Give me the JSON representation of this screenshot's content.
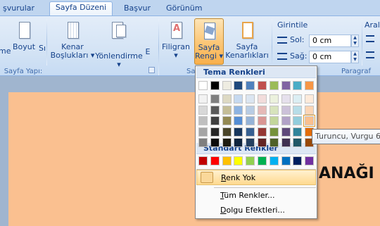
{
  "tabs": [
    {
      "label": "şvurular",
      "active": false
    },
    {
      "label": "Sayfa Düzeni",
      "active": true
    },
    {
      "label": "Başvur",
      "active": false
    },
    {
      "label": "Görünüm",
      "active": false
    }
  ],
  "ribbon": {
    "page_setup": {
      "label": "Sayfa Yapı:",
      "buttons": {
        "edge": "me",
        "size": "Boyut",
        "su": "Sı",
        "margins_1": "Kenar",
        "margins_2": "Boşlukları ▾",
        "orientation": "Yönlendirme ▾",
        "more": "E"
      }
    },
    "page_bg": {
      "label": "Sa",
      "buttons": {
        "watermark_1": "Filigran",
        "watermark_2": "▾",
        "color_1": "Sayfa",
        "color_2": "Rengi ▾",
        "borders_1": "Sayfa",
        "borders_2": "Kenarlıkları"
      }
    },
    "paragraph": {
      "label": "Paragraf",
      "indent_title": "Girintile",
      "left_label": "Sol:",
      "left_value": "0 cm",
      "right_label": "Sağ:",
      "right_value": "0 cm",
      "spacing_title": "Aralı"
    }
  },
  "menu": {
    "theme_header": "Tema Renkleri",
    "standard_header": "Standart Renkler",
    "no_color": {
      "prefix": "R",
      "rest": "enk Yok"
    },
    "more_colors": {
      "prefix": "T",
      "rest": "üm Renkler..."
    },
    "fill_effects": {
      "prefix": "D",
      "rest": "olgu Efektleri..."
    }
  },
  "theme_top": [
    "#ffffff",
    "#000000",
    "#eeece1",
    "#1f497d",
    "#4f81bd",
    "#c0504d",
    "#9bbb59",
    "#8064a2",
    "#4bacc6",
    "#f79646"
  ],
  "theme_shades": [
    [
      "#f2f2f2",
      "#d8d8d8",
      "#bfbfbf",
      "#a5a5a5",
      "#7f7f7f"
    ],
    [
      "#7f7f7f",
      "#595959",
      "#3f3f3f",
      "#262626",
      "#0c0c0c"
    ],
    [
      "#ddd9c3",
      "#c4bd97",
      "#938953",
      "#494429",
      "#1d1b10"
    ],
    [
      "#c6d9f0",
      "#8db3e2",
      "#548dd4",
      "#17365d",
      "#0f243e"
    ],
    [
      "#dbe5f1",
      "#b8cce4",
      "#95b3d7",
      "#366092",
      "#244061"
    ],
    [
      "#f2dcdb",
      "#e5b9b7",
      "#d99694",
      "#953734",
      "#632423"
    ],
    [
      "#ebf1dd",
      "#d7e3bc",
      "#c3d69b",
      "#76923c",
      "#4f6128"
    ],
    [
      "#e5e0ec",
      "#ccc1d9",
      "#b2a2c7",
      "#5f497a",
      "#3f3151"
    ],
    [
      "#dbeef3",
      "#b7dde8",
      "#92cddc",
      "#31859b",
      "#205867"
    ],
    [
      "#fdeada",
      "#fbd5b5",
      "#fac08f",
      "#e36c09",
      "#974806"
    ]
  ],
  "standard": [
    "#c00000",
    "#ff0000",
    "#ffc000",
    "#ffff00",
    "#92d050",
    "#00b050",
    "#00b0f0",
    "#0070c0",
    "#002060",
    "#7030a0"
  ],
  "tooltip": "Turuncu, Vurgu 6,",
  "document": {
    "heading": "ANAĞI",
    "page_color": "#fac090"
  }
}
